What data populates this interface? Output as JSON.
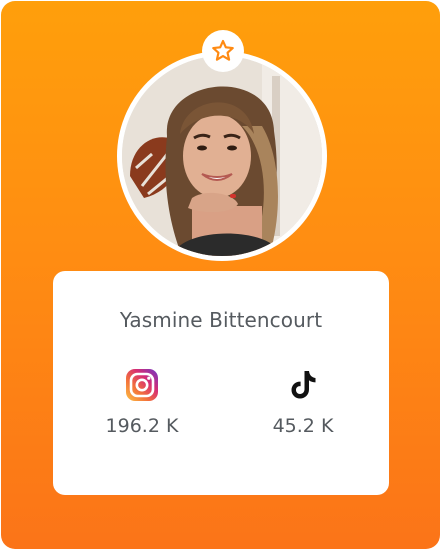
{
  "profile": {
    "name": "Yasmine Bittencourt",
    "badge_icon": "star-icon",
    "colors": {
      "gradient_top": "#ff9f0b",
      "gradient_bottom": "#fb7418",
      "accent": "#ff8a12",
      "text": "#555a5f"
    }
  },
  "stats": [
    {
      "platform_icon": "instagram-icon",
      "count": "196.2 K"
    },
    {
      "platform_icon": "tiktok-icon",
      "count": "45.2 K"
    }
  ]
}
